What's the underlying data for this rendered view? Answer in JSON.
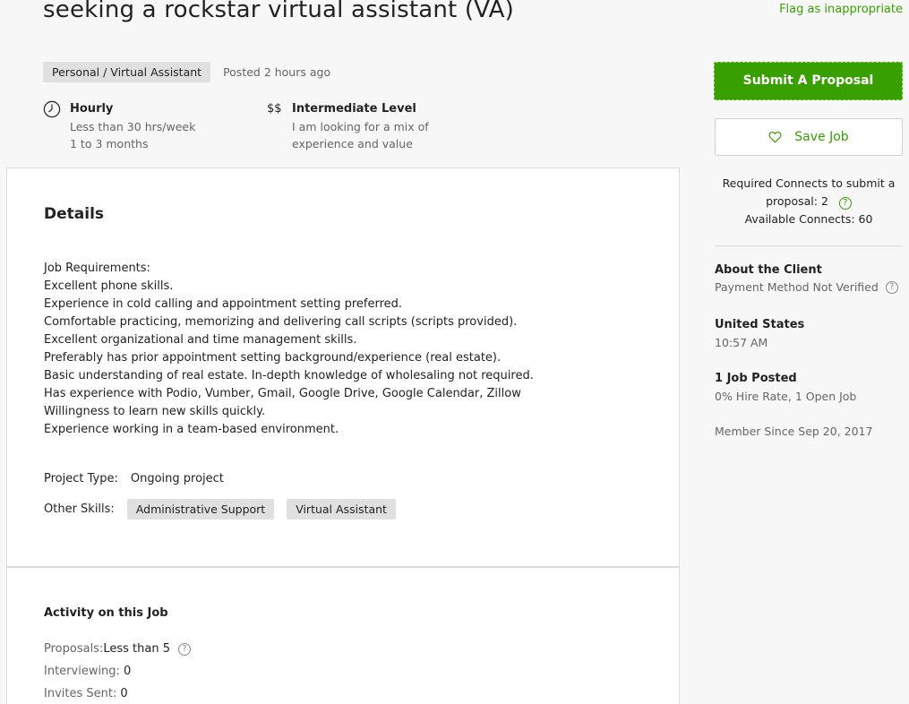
{
  "job": {
    "title": "seeking a rockstar virtual assistant (VA)",
    "flag_label": "Flag as inappropriate",
    "category": "Personal / Virtual Assistant",
    "posted": "Posted 2 hours ago",
    "rate": {
      "title": "Hourly",
      "hours": "Less than 30 hrs/week",
      "duration": "1 to 3 months",
      "icon": "clock-icon"
    },
    "level": {
      "symbol": "$$",
      "title": "Intermediate Level",
      "line1": "I am looking for a mix of",
      "line2": "experience and value"
    }
  },
  "details": {
    "heading": "Details",
    "description": [
      "Job Requirements:",
      "Excellent phone skills.",
      "Experience in cold calling and appointment setting preferred.",
      "Comfortable practicing, memorizing and delivering call scripts (scripts provided).",
      "Excellent organizational and time management skills.",
      "Preferably has prior appointment setting background/experience (real estate).",
      "Basic understanding of real estate. In-depth knowledge of wholesaling not required.",
      "Has experience with Podio, Vumber, Gmail, Google Drive, Google Calendar, Zillow",
      "Willingness to learn new skills quickly.",
      "Experience working in a team-based environment."
    ],
    "project_type_label": "Project Type:",
    "project_type_value": "Ongoing project",
    "other_skills_label": "Other Skills:",
    "skills": [
      "Administrative Support",
      "Virtual Assistant"
    ]
  },
  "activity": {
    "heading": "Activity on this Job",
    "proposals_label": "Proposals:",
    "proposals_value": "Less than 5",
    "interviewing_label": "Interviewing:",
    "interviewing_value": "0",
    "invites_label": "Invites Sent:",
    "invites_value": "0"
  },
  "sidebar": {
    "submit_label": "Submit A Proposal",
    "save_label": "Save Job",
    "connects_line1": "Required Connects to submit a",
    "connects_line2": "proposal: 2",
    "connects_line3": "Available Connects: 60",
    "about_heading": "About the Client",
    "payment": "Payment Method Not Verified",
    "country": "United States",
    "time": "10:57 AM",
    "jobs_posted": "1 Job Posted",
    "hire_rate": "0% Hire Rate, 1 Open Job",
    "member_since": "Member Since Sep 20, 2017"
  },
  "colors": {
    "accent": "#37a000",
    "tag_bg": "#e0e0e0",
    "muted_text": "#656565",
    "page_bg": "#f7f7f7"
  }
}
